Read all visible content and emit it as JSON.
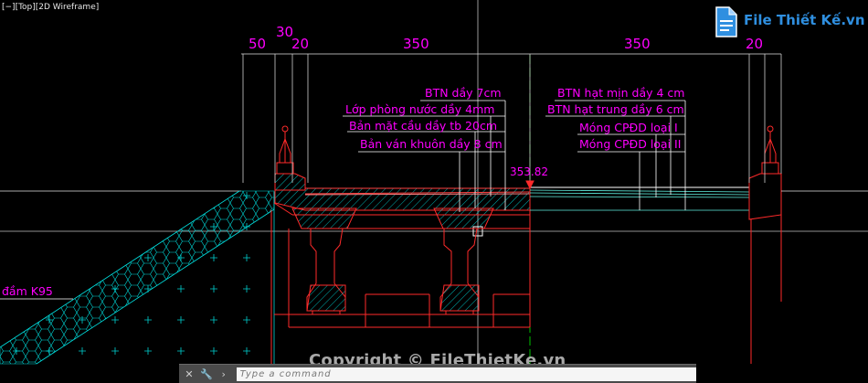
{
  "viewport_label": "[−][Top][2D Wireframe]",
  "dimensions": {
    "top_left_50": "50",
    "top_left_30": "30",
    "top_left_20": "20",
    "top_mid_350": "350",
    "top_right_350": "350",
    "top_right_20": "20"
  },
  "annotations_left": [
    "BTN dầy 7cm",
    "Lớp phòng nước dầy 4mm",
    "Bản mặt cầu dầy tb 20cm",
    "Bản ván khuôn dầy 8 cm"
  ],
  "annotations_right": [
    "BTN hạt mịn dầy 4 cm",
    "BTN hạt trung dầy 6 cm",
    "Móng CPĐD loại I",
    "Móng CPĐD loại II"
  ],
  "elevation": "353.82",
  "left_label": "đầm K95",
  "command": {
    "placeholder": "Type a command",
    "close_symbol": "✕",
    "tool_symbol": "🔧"
  },
  "watermark": "Copyright © FileThietKe.vn",
  "logo": {
    "text": "File Thiết Kế",
    "ext": ".vn"
  },
  "colors": {
    "background": "#000000",
    "dimension": "#ff00ff",
    "structure_red": "#ff2a2a",
    "hatch_cyan": "#00e0e0",
    "layer_cyan": "#60f0e0",
    "leader_white": "#ffffff",
    "crosshair": "#bfbfbf",
    "green_axis": "#00c000",
    "logo_blue": "#2f8fe0"
  }
}
